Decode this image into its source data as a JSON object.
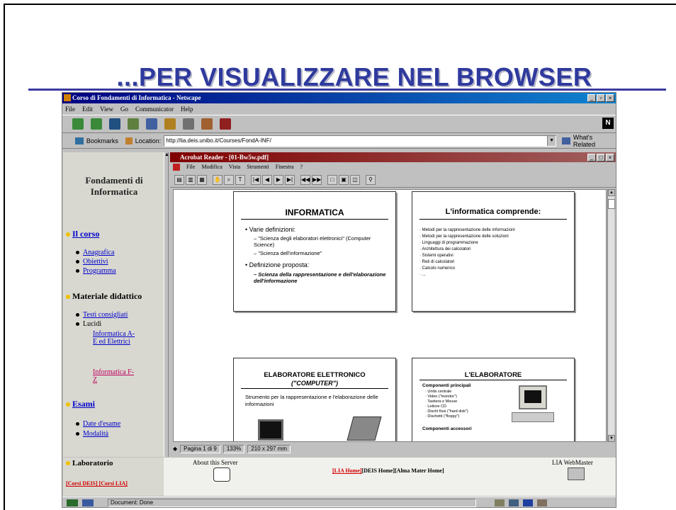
{
  "slide": {
    "title": "...PER VISUALIZZARE NEL BROWSER"
  },
  "browser": {
    "title": "Corso di Fondamenti di Informatica - Netscape",
    "menu": [
      "File",
      "Edit",
      "View",
      "Go",
      "Communicator",
      "Help"
    ],
    "bookmarks_label": "Bookmarks",
    "location_label": "Location:",
    "location_value": "http://lia.deis.unibo.it/Courses/FondA-INF/",
    "whats_related": "What's Related",
    "throbber": "N",
    "status_text": "Document: Done"
  },
  "left_frame": {
    "heading": "Fondamenti di Informatica",
    "sections": [
      {
        "label": "Il corso",
        "items": [
          "Anagrafica",
          "Obiettivi",
          "Programma"
        ]
      },
      {
        "label": "Materiale didattico",
        "items": [
          "Testi consigliati",
          "Lucidi"
        ],
        "subitems": [
          "Informatica A-E ed Elettrici",
          "Informatica F-Z"
        ]
      },
      {
        "label": "Esami",
        "items": [
          "Date d'esame",
          "Modalità"
        ]
      },
      {
        "label": "Laboratorio"
      }
    ],
    "bottom_links": "[Corsi DEIS] [Corsi LIA]"
  },
  "acrobat": {
    "title": "Acrobat Reader - [01-Bw5w.pdf]",
    "menu": [
      "File",
      "Modifica",
      "Vista",
      "Strumenti",
      "Finestra",
      "?"
    ],
    "status": {
      "page": "Pagina 1 di 9",
      "zoom": "133%",
      "size": "210 x 297 mm"
    },
    "slides": [
      {
        "title": "INFORMATICA",
        "bullets": [
          "Varie definizioni:",
          "– \"Scienza degli elaboratori elettronici\" (Computer Science)",
          "– \"Scienza dell'informazione\"",
          "Definizione proposta:",
          "– Scienza della rappresentazione e dell'elaborazione dell'informazione"
        ]
      },
      {
        "title": "L'informatica comprende:",
        "bullets": [
          "Metodi per la rappresentazione delle informazioni",
          "Metodi per la rappresentazione delle soluzioni",
          "Linguaggi di programmazione",
          "Architettura dei calcolatori",
          "Sistemi operativi",
          "Reti di calcolatori",
          "Calcolo numerico",
          "..."
        ]
      },
      {
        "title": "ELABORATORE ELETTRONICO",
        "subtitle": "(\"COMPUTER\")",
        "text": "Strumento per la rappresentazione e l'elaborazione delle informazioni"
      },
      {
        "title": "L'ELABORATORE",
        "sub_head": "Componenti principali",
        "bullets": [
          "Unità centrale",
          "Video (\"monitor\")",
          "Tastiera e Mouse",
          "Lettore CD",
          "Dischi fissi (\"hard disk\")",
          "Dischetti (\"floppy\")"
        ],
        "sub_head2": "Componenti accessori"
      }
    ]
  },
  "bottom_frame": {
    "about": "About this Server",
    "links_red": "[LIA Home]",
    "links": "[DEIS Home][Alma Mater Home]",
    "webmaster": "LIA WebMaster"
  }
}
